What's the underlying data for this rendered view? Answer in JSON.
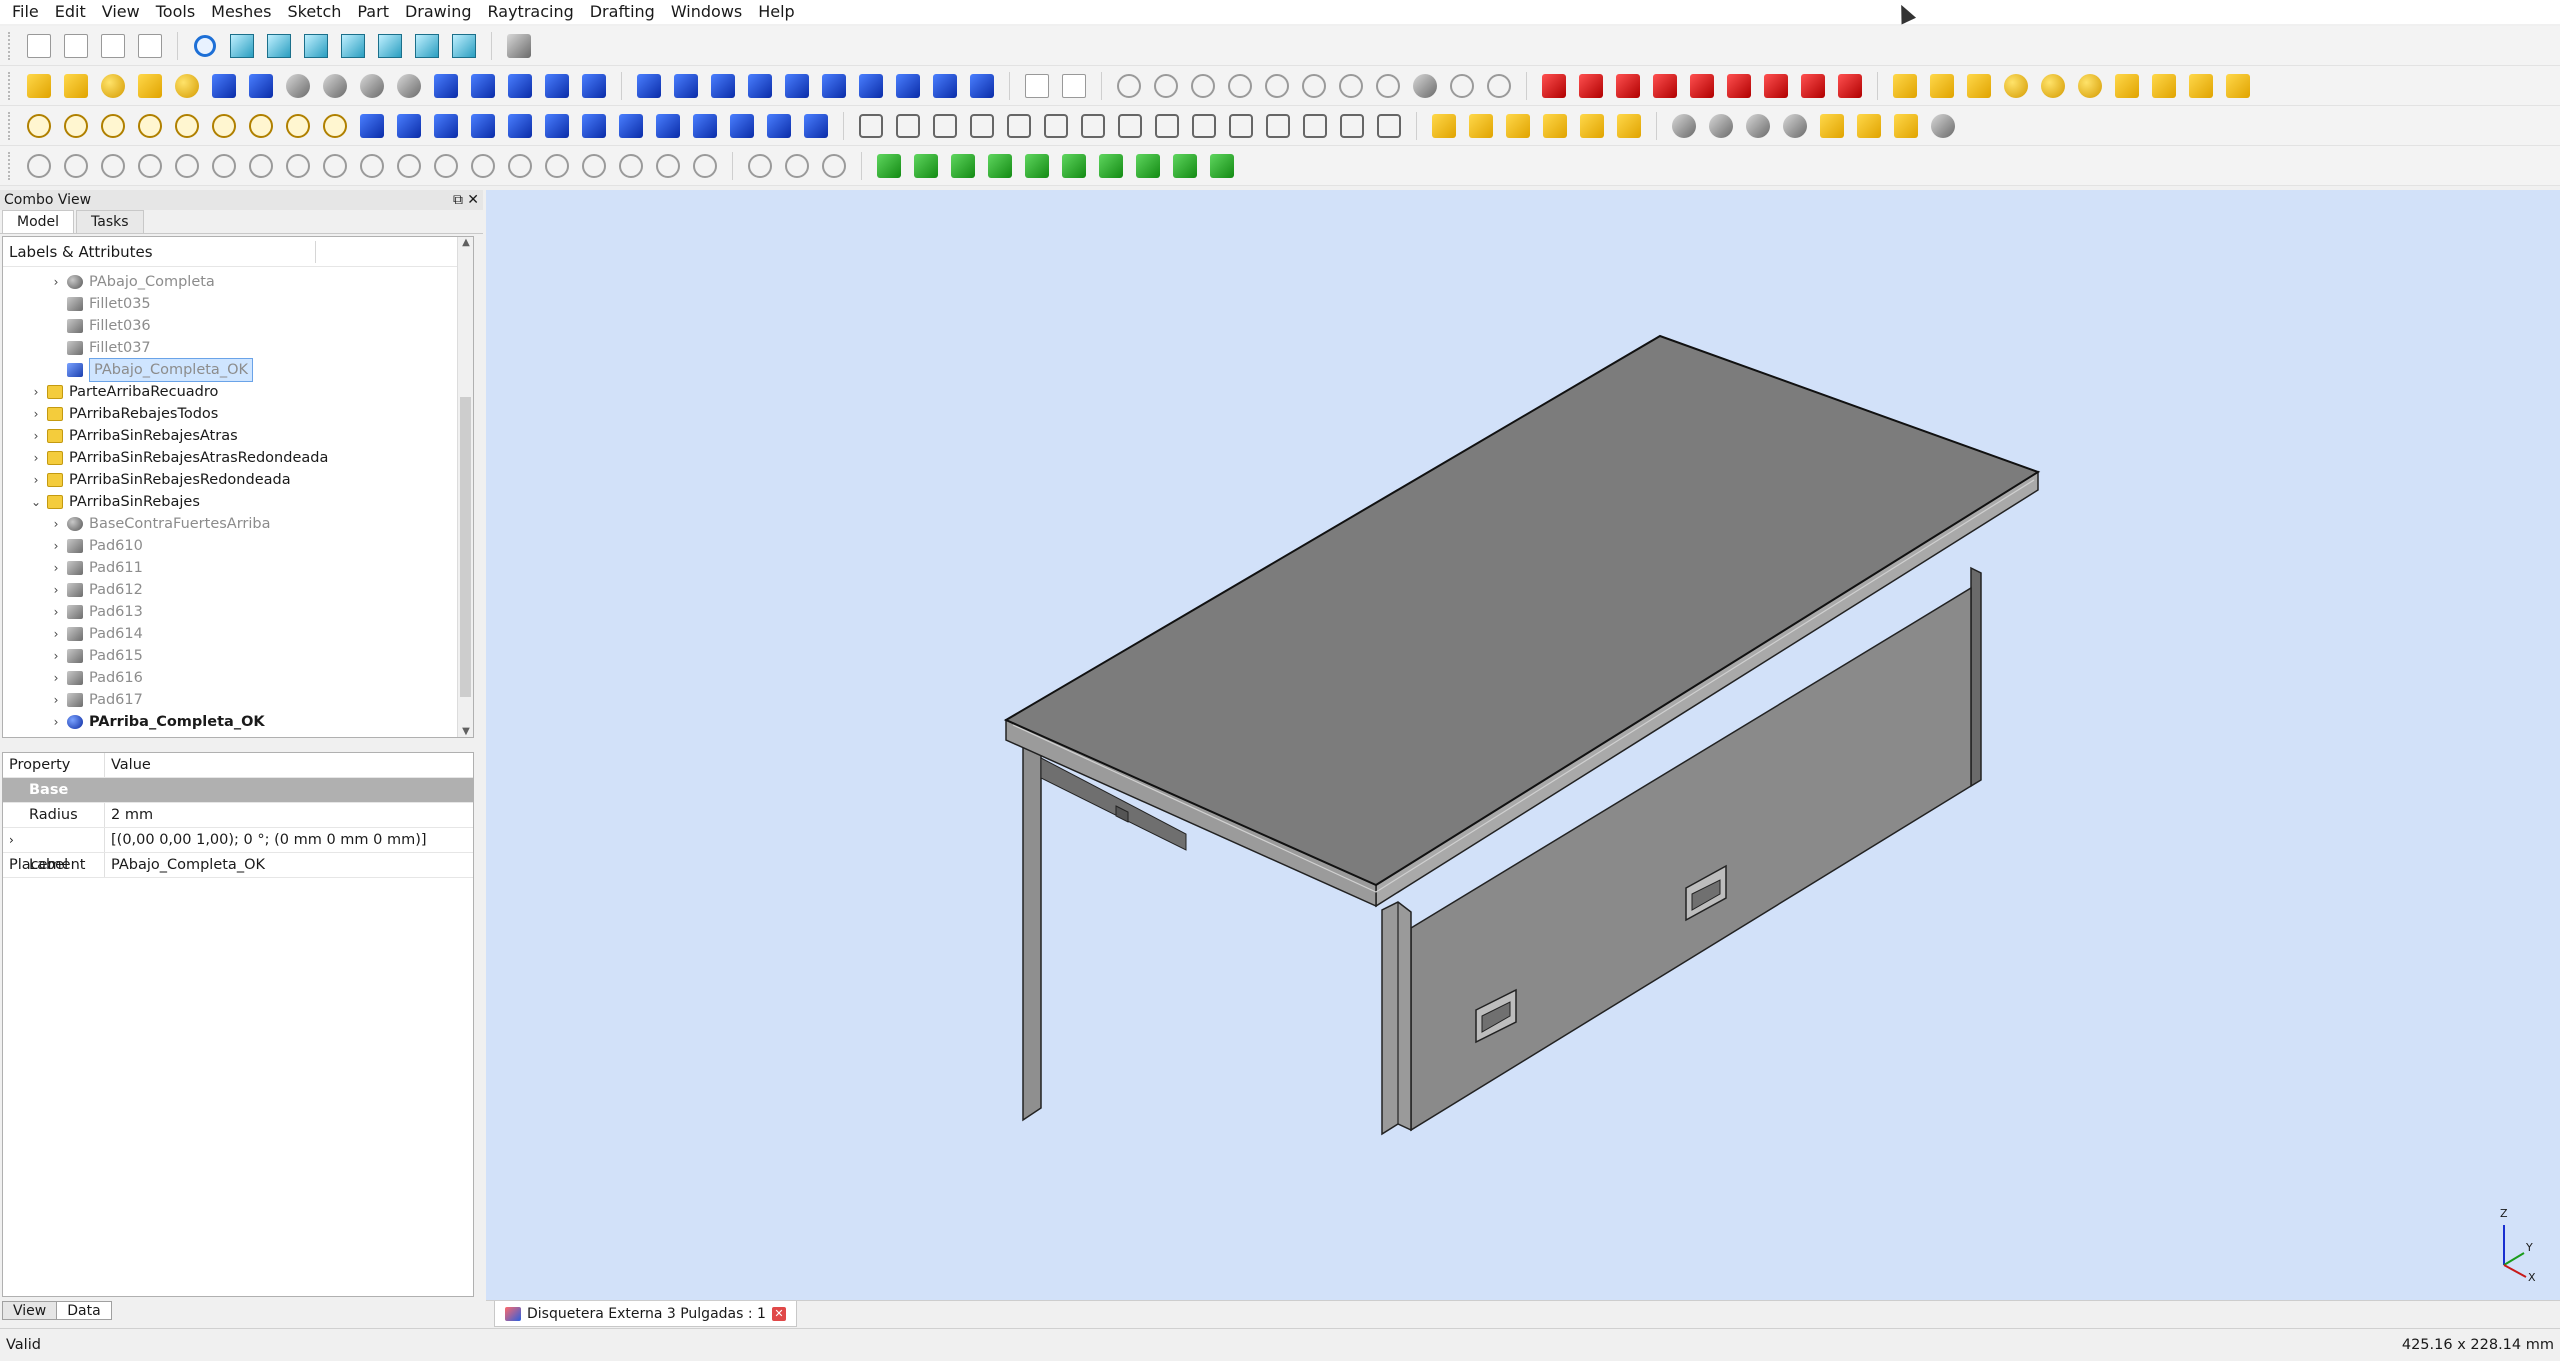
{
  "menu": [
    "File",
    "Edit",
    "View",
    "Tools",
    "Meshes",
    "Sketch",
    "Part",
    "Drawing",
    "Raytracing",
    "Drafting",
    "Windows",
    "Help"
  ],
  "toolbar_rows": [
    [
      "new-document-icon",
      "a3-page-icon",
      "open-drawing-icon",
      "save-drawing-icon",
      "|",
      "fit-all-icon",
      "axonometric-view-icon",
      "front-view-icon",
      "top-view-icon",
      "right-view-icon",
      "rear-view-icon",
      "bottom-view-icon",
      "left-view-icon",
      "|",
      "measure-icon"
    ],
    [
      "box-icon",
      "cylinder-icon",
      "sphere-icon",
      "cone-icon",
      "torus-icon",
      "create-primitives-icon",
      "shape-builder-icon",
      "boolean-icon",
      "cut-icon",
      "fuse-icon",
      "common-icon",
      "extrude-icon",
      "revolve-icon",
      "mirror-icon",
      "fillet-icon",
      "chamfer-icon",
      "|",
      "layer-icon",
      "make-face-icon",
      "ruled-surface-icon",
      "loft-icon",
      "sweep-icon",
      "section-icon",
      "cross-section-icon",
      "offset-icon",
      "thickness-icon",
      "projection-icon",
      "|",
      "drawing-page-icon",
      "export-icon",
      "|",
      "point-icon",
      "line-icon",
      "arc-icon",
      "circle-icon",
      "polyline-icon",
      "spline-icon",
      "rectangle-icon",
      "trim-icon",
      "cut-sketch-icon",
      "external-icon",
      "construction-icon",
      "|",
      "draft-tool-icon",
      "draft-move-icon",
      "draft-rotate-icon",
      "draft-offset-icon",
      "draft-upgrade-icon",
      "draft-downgrade-icon",
      "draft-array-icon",
      "draft-clone-icon",
      "draft-shape-icon",
      "|",
      "part-box-icon",
      "part-cylinder-icon",
      "part-cone-icon",
      "part-sphere-icon",
      "part-ellipsoid-icon",
      "part-torus-icon",
      "part-prism-icon",
      "part-wedge-icon",
      "part-helix-icon",
      "part-plane-icon"
    ],
    [
      "sketch-line-icon",
      "sketch-polyline-icon",
      "sketch-circle-icon",
      "sketch-arc-icon",
      "sketch-rectangle-icon",
      "sketch-polygon-icon",
      "sketch-slot-icon",
      "text-icon",
      "dimension-icon",
      "move-icon",
      "rotate-icon",
      "offset-icon",
      "mirror-icon",
      "upgrade-icon",
      "downgrade-icon",
      "scale-icon",
      "edit-icon",
      "shape2dview-icon",
      "wireline-icon",
      "snap-icon",
      "array-icon",
      "clone-icon",
      "|",
      "point-constraint-icon",
      "fillet-constraint-icon",
      "vertical-constraint-icon",
      "horizontal-constraint-icon",
      "parallel-constraint-icon",
      "perpendicular-constraint-icon",
      "tangent-constraint-icon",
      "equal-constraint-icon",
      "symmetric-constraint-icon",
      "lock-constraint-icon",
      "distance-x-icon",
      "distance-y-icon",
      "distance-icon",
      "radius-icon",
      "angle-icon",
      "|",
      "part-bool-icon",
      "part-cut-icon",
      "part-fuse-icon",
      "display-mode-icon",
      "view-sketch-icon",
      "leave-sketch-icon",
      "|",
      "refine-shape-icon",
      "check-geometry-icon",
      "defeaturing-icon",
      "shell-icon",
      "extrude-part-icon",
      "sweep-part-icon",
      "loft-part-icon",
      "compound-icon"
    ],
    [
      "curve-1-icon",
      "curve-2-icon",
      "curve-3-icon",
      "curve-4-icon",
      "curve-5-icon",
      "curve-6-icon",
      "curve-7-icon",
      "curve-8-icon",
      "curve-9-icon",
      "curve-10-icon",
      "curve-11-icon",
      "curve-12-icon",
      "curve-13-icon",
      "curve-14-icon",
      "curve-15-icon",
      "curve-16-icon",
      "curve-17-icon",
      "curve-18-icon",
      "curve-19-icon",
      "|",
      "curve-20-icon",
      "curve-21-icon",
      "curve-22-icon",
      "|",
      "mesh-from-shape-icon",
      "mesh-flip-icon",
      "mesh-harmonize-icon",
      "mesh-smooth-icon",
      "mesh-boolean-icon",
      "mesh-evaluate-icon",
      "mesh-fill-icon",
      "mesh-segment-icon",
      "mesh-curvature-icon",
      "mesh-cut-icon"
    ]
  ],
  "combo": {
    "title": "Combo View",
    "tabs": [
      "Model",
      "Tasks"
    ],
    "tree_header": "Labels & Attributes",
    "tree": [
      {
        "label": "PAbajo_Completa",
        "indent": 2,
        "expand": "›",
        "icon": "ball",
        "style": "grey"
      },
      {
        "label": "Fillet035",
        "indent": 2,
        "expand": "",
        "icon": "solid",
        "style": "grey"
      },
      {
        "label": "Fillet036",
        "indent": 2,
        "expand": "",
        "icon": "solid",
        "style": "grey"
      },
      {
        "label": "Fillet037",
        "indent": 2,
        "expand": "",
        "icon": "solid",
        "style": "grey"
      },
      {
        "label": "PAbajo_Completa_OK",
        "indent": 2,
        "expand": "",
        "icon": "bluesolid",
        "style": "selected"
      },
      {
        "label": "ParteArribaRecuadro",
        "indent": 1,
        "expand": "›",
        "icon": "folder",
        "style": ""
      },
      {
        "label": "PArribaRebajesTodos",
        "indent": 1,
        "expand": "›",
        "icon": "folder",
        "style": ""
      },
      {
        "label": "PArribaSinRebajesAtras",
        "indent": 1,
        "expand": "›",
        "icon": "folder",
        "style": ""
      },
      {
        "label": "PArribaSinRebajesAtrasRedondeada",
        "indent": 1,
        "expand": "›",
        "icon": "folder",
        "style": ""
      },
      {
        "label": "PArribaSinRebajesRedondeada",
        "indent": 1,
        "expand": "›",
        "icon": "folder",
        "style": ""
      },
      {
        "label": "PArribaSinRebajes",
        "indent": 1,
        "expand": "⌄",
        "icon": "folder",
        "style": ""
      },
      {
        "label": "BaseContraFuertesArriba",
        "indent": 2,
        "expand": "›",
        "icon": "ball",
        "style": "grey"
      },
      {
        "label": "Pad610",
        "indent": 2,
        "expand": "›",
        "icon": "solid",
        "style": "grey"
      },
      {
        "label": "Pad611",
        "indent": 2,
        "expand": "›",
        "icon": "solid",
        "style": "grey"
      },
      {
        "label": "Pad612",
        "indent": 2,
        "expand": "›",
        "icon": "solid",
        "style": "grey"
      },
      {
        "label": "Pad613",
        "indent": 2,
        "expand": "›",
        "icon": "solid",
        "style": "grey"
      },
      {
        "label": "Pad614",
        "indent": 2,
        "expand": "›",
        "icon": "solid",
        "style": "grey"
      },
      {
        "label": "Pad615",
        "indent": 2,
        "expand": "›",
        "icon": "solid",
        "style": "grey"
      },
      {
        "label": "Pad616",
        "indent": 2,
        "expand": "›",
        "icon": "solid",
        "style": "grey"
      },
      {
        "label": "Pad617",
        "indent": 2,
        "expand": "›",
        "icon": "solid",
        "style": "grey"
      },
      {
        "label": "PArriba_Completa_OK",
        "indent": 2,
        "expand": "›",
        "icon": "blueball",
        "style": "bold"
      }
    ],
    "props": {
      "header_property": "Property",
      "header_value": "Value",
      "group": "Base",
      "rows": [
        {
          "name": "Radius",
          "value": "2 mm",
          "expand": ""
        },
        {
          "name": "Placement",
          "value": "[(0,00 0,00 1,00); 0 °; (0 mm  0 mm  0 mm)]",
          "expand": "›"
        },
        {
          "name": "Label",
          "value": "PAbajo_Completa_OK",
          "expand": ""
        }
      ]
    },
    "bottom_tabs": [
      "View",
      "Data"
    ]
  },
  "view": {
    "background": "#d2e1f9",
    "document_tab": "Disquetera Externa 3 Pulgadas : 1",
    "document_tab_close": "✕",
    "axis": {
      "z": "Z",
      "y": "Y",
      "x": "X"
    }
  },
  "status": {
    "left": "Valid",
    "right": "425.16 x 228.14 mm"
  }
}
